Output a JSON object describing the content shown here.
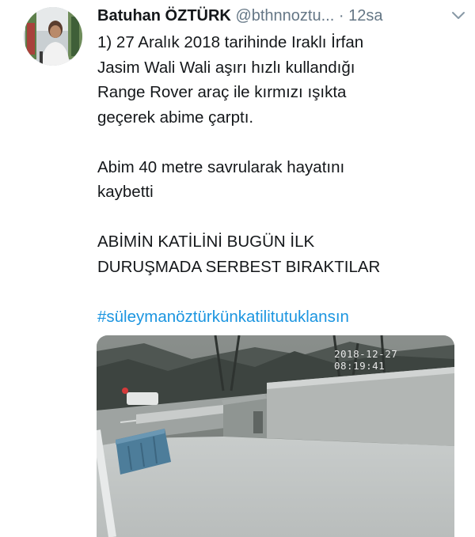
{
  "tweet": {
    "author_name": "Batuhan ÖZTÜRK",
    "author_handle": "@bthnnoztu...",
    "separator": "·",
    "time": "12sa",
    "lines": [
      "1) 27 Aralık 2018 tarihinde Iraklı İrfan",
      "Jasim Wali Wali aşırı hızlı kullandığı",
      "Range Rover araç ile kırmızı ışıkta",
      "geçerek abime çarptı.",
      "",
      "Abim 40 metre savrularak hayatını",
      "kaybetti",
      "",
      "ABİMİN KATİLİNİ BUGÜN İLK",
      "DURUŞMADA SERBEST BIRAKTILAR",
      "",
      "#süleymanöztürkünkatilitutuklansın"
    ],
    "hashtag_color": "#1b95e0"
  },
  "media": {
    "timestamp": "2018-12-27 08:19:41"
  },
  "icons": {
    "menu": "chevron-down-icon"
  }
}
